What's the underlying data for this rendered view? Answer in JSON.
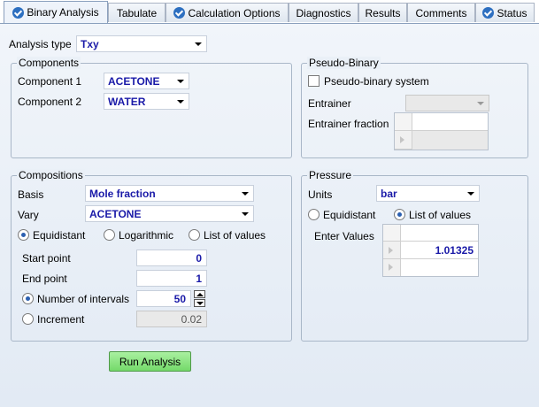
{
  "tabs": [
    {
      "label": "Binary Analysis",
      "checked": true,
      "active": true
    },
    {
      "label": "Tabulate",
      "checked": false
    },
    {
      "label": "Calculation Options",
      "checked": true
    },
    {
      "label": "Diagnostics",
      "checked": false
    },
    {
      "label": "Results",
      "checked": false
    },
    {
      "label": "Comments",
      "checked": false
    },
    {
      "label": "Status",
      "checked": true
    }
  ],
  "analysis_type": {
    "label": "Analysis type",
    "value": "Txy"
  },
  "components": {
    "title": "Components",
    "component1_label": "Component 1",
    "component1_value": "ACETONE",
    "component2_label": "Component 2",
    "component2_value": "WATER"
  },
  "pseudo_binary": {
    "title": "Pseudo-Binary",
    "checkbox_label": "Pseudo-binary system",
    "checked": false,
    "entrainer_label": "Entrainer",
    "entrainer_value": "",
    "entrainer_fraction_label": "Entrainer fraction"
  },
  "compositions": {
    "title": "Compositions",
    "basis_label": "Basis",
    "basis_value": "Mole fraction",
    "vary_label": "Vary",
    "vary_value": "ACETONE",
    "opt_equidistant": "Equidistant",
    "opt_logarithmic": "Logarithmic",
    "opt_list": "List of values",
    "start_label": "Start point",
    "start_value": "0",
    "end_label": "End point",
    "end_value": "1",
    "intervals_label": "Number of intervals",
    "intervals_value": "50",
    "increment_label": "Increment",
    "increment_value": "0.02"
  },
  "pressure": {
    "title": "Pressure",
    "units_label": "Units",
    "units_value": "bar",
    "opt_equidistant": "Equidistant",
    "opt_list": "List of values",
    "enter_values_label": "Enter Values",
    "values": [
      "1.01325"
    ]
  },
  "run_button": "Run Analysis",
  "colors": {
    "accent": "#2d6fc0",
    "value_text": "#1a1aa8",
    "run_button": "#86e07c"
  }
}
